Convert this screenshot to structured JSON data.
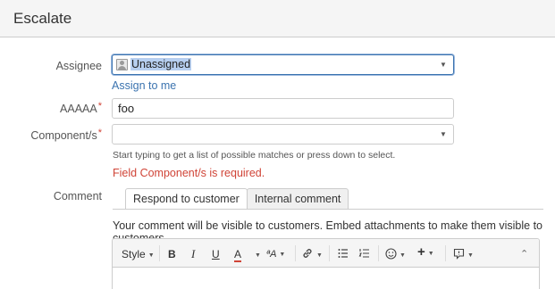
{
  "dialog": {
    "title": "Escalate"
  },
  "assignee": {
    "label": "Assignee",
    "value": "Unassigned",
    "assign_to_me": "Assign to me"
  },
  "aaaaa": {
    "label": "AAAAA",
    "value": "foo"
  },
  "components": {
    "label": "Component/s",
    "value": "",
    "hint": "Start typing to get a list of possible matches or press down to select.",
    "error": "Field Component/s is required."
  },
  "comment": {
    "label": "Comment",
    "tabs": [
      "Respond to customer",
      "Internal comment"
    ],
    "active_tab": "Respond to customer",
    "note": "Your comment will be visible to customers. Embed attachments to make them visible to customers."
  },
  "toolbar": {
    "style": "Style",
    "bold": "B",
    "italic": "I",
    "underline": "U",
    "text_color": "A",
    "more_formatting": "ªA",
    "collapse": "⌃"
  },
  "required_marker": "*",
  "colors": {
    "link": "#3b73af",
    "error": "#d04437",
    "focus": "#3b73af"
  }
}
